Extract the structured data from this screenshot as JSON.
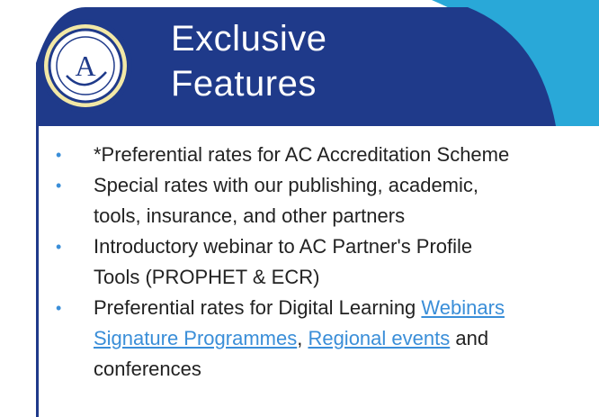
{
  "colors": {
    "banner": "#1f3a8a",
    "banner_accent": "#29a8d8",
    "bullet": "#3a8ed8",
    "link": "#3a8ed8",
    "logo_ring": "#f2e8a6"
  },
  "header": {
    "title_line1": "Exclusive",
    "title_line2": "Features",
    "logo_icon": "ac-logo-icon",
    "logo_text": "A"
  },
  "features": [
    {
      "lines": [
        "*Preferential rates for AC Accreditation Scheme"
      ]
    },
    {
      "lines": [
        "Special rates with our publishing, academic,",
        "tools, insurance, and other partners"
      ]
    },
    {
      "lines": [
        "Introductory webinar to AC Partner's Profile",
        "Tools (PROPHET & ECR)"
      ]
    },
    {
      "line1_prefix": "Preferential rates for Digital Learning ",
      "link_webinars": "Webinars",
      "link_signature": "Signature Programmes",
      "separator": ", ",
      "link_regional": "Regional events",
      "suffix": " and",
      "line3": "conferences"
    }
  ]
}
